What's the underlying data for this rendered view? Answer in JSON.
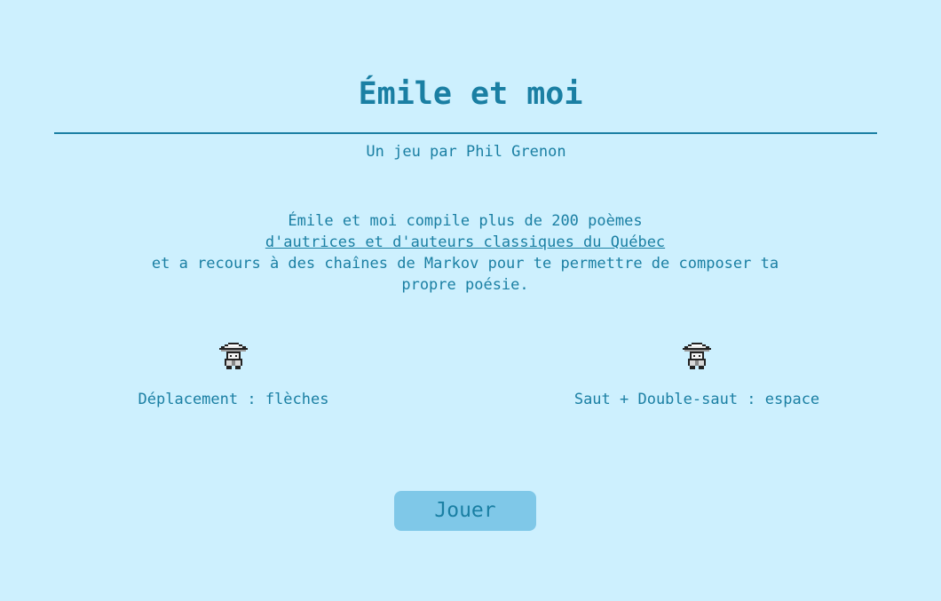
{
  "title": "Émile et moi",
  "byline": "Un jeu par Phil Grenon",
  "intro": {
    "line1": "Émile et moi compile plus de 200 poèmes",
    "link": "d'autrices et d'auteurs classiques du Québec",
    "line3": "et a recours à des chaînes de Markov pour te permettre de composer ta propre poésie."
  },
  "controls": [
    {
      "icon": "character-icon",
      "label": "Déplacement : flèches"
    },
    {
      "icon": "character-icon",
      "label": "Saut + Double-saut : espace"
    }
  ],
  "play_button": "Jouer",
  "colors": {
    "background": "#cdf0fe",
    "text": "#1a7fa3",
    "button": "#7fc8e8"
  }
}
